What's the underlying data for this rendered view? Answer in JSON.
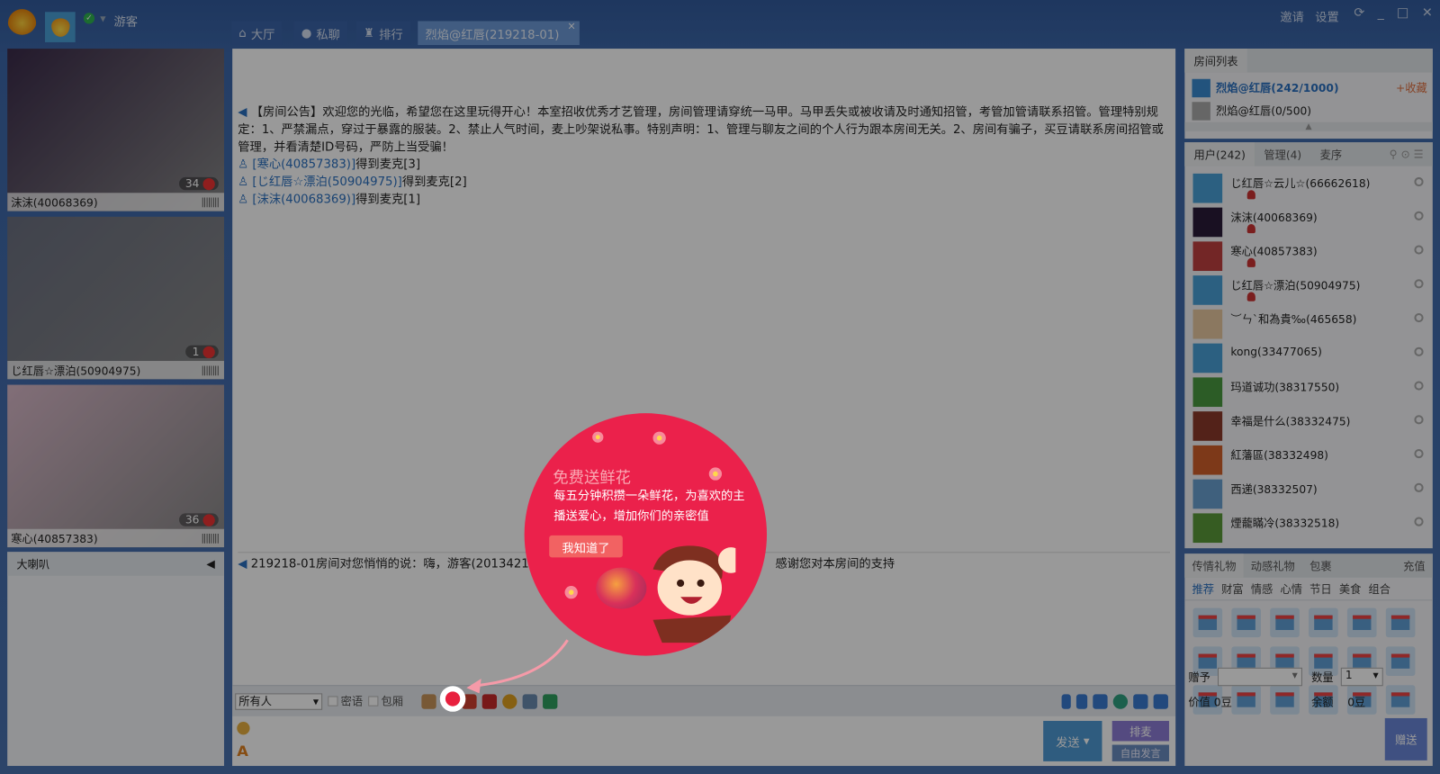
{
  "topbar": {
    "user": "游客",
    "tabs": [
      {
        "label": "大厅",
        "icon": "home-icon"
      },
      {
        "label": "私聊",
        "icon": "chat-bubbles-icon"
      },
      {
        "label": "排行",
        "icon": "trophy-icon"
      },
      {
        "label": "烈焰@红唇(219218-01)",
        "close": "×"
      }
    ],
    "links": [
      "邀请",
      "设置"
    ],
    "win": [
      "⟳",
      "_",
      "□",
      "✕"
    ]
  },
  "videos": [
    {
      "name": "沫沫(40068369)",
      "count": "34",
      "bg": "#3b2b4a"
    },
    {
      "name": "じ红唇☆漂泊(50904975)",
      "count": "1",
      "bg": "#6b7080"
    },
    {
      "name": "寒心(40857383)",
      "count": "36",
      "bg": "#d8b8c8"
    }
  ],
  "horn": {
    "title": "大喇叭"
  },
  "chat": {
    "announce_tag": "【房间公告】",
    "announce": "欢迎您的光临，希望您在这里玩得开心！本室招收优秀才艺管理，房间管理请穿统一马甲。马甲丢失或被收请及时通知招管，考管加管请联系招管。管理特别规定：1、严禁漏点，穿过于暴露的服装。2、禁止人气时间，麦上吵架说私事。特别声明：1、管理与聊友之间的个人行为跟本房间无关。2、房间有骗子，买豆请联系房间招管或管理，并看清楚ID号码，严防上当受骗！",
    "mic": [
      {
        "user": "[寒心(40857383)]",
        "text": "得到麦克[3]"
      },
      {
        "user": "[じ红唇☆漂泊(50904975)]",
        "text": "得到麦克[2]"
      },
      {
        "user": "[沫沫(40068369)]",
        "text": "得到麦克[1]"
      }
    ],
    "private_msg_a": "219218-01房间对您悄悄的说：嗨，游客(20134212",
    "private_msg_b": "感谢您对本房间的支持"
  },
  "toolbar": {
    "target": "所有人",
    "whisper": "密语",
    "private_room": "包厢"
  },
  "input": {
    "send": "发送",
    "queue": "排麦",
    "free": "自由发言"
  },
  "rooms": {
    "title": "房间列表",
    "items": [
      {
        "name": "烈焰@红唇(242/1000)",
        "fav": "+收藏"
      },
      {
        "name": "烈焰@红唇(0/500)"
      }
    ]
  },
  "users": {
    "tabs": [
      "用户(242)",
      "管理(4)",
      "麦序"
    ],
    "list": [
      {
        "name": "じ红唇☆云儿☆(66662618)",
        "av": "#4aa0d8",
        "mic": true
      },
      {
        "name": "沫沫(40068369)",
        "av": "#2a1c3a",
        "mic": true
      },
      {
        "name": "寒心(40857383)",
        "av": "#c04040",
        "mic": true
      },
      {
        "name": "じ红唇☆漂泊(50904975)",
        "av": "#4aa0d8",
        "mic": true
      },
      {
        "name": "︶ㄣ`和為貴‰(465658)",
        "av": "#e8c8a0"
      },
      {
        "name": "kong(33477065)",
        "av": "#4aa0d8"
      },
      {
        "name": "玛道诚功(38317550)",
        "av": "#4a9a40"
      },
      {
        "name": "幸福是什么(38332475)",
        "av": "#8a3a2a"
      },
      {
        "name": "紅藩區(38332498)",
        "av": "#d0602a"
      },
      {
        "name": "西递(38332507)",
        "av": "#6aa0d0"
      },
      {
        "name": "煙蘢瞞冷(38332518)",
        "av": "#5a9a3a"
      }
    ]
  },
  "gifts": {
    "tabs": [
      "传情礼物",
      "动感礼物",
      "包裹"
    ],
    "recharge": "充值",
    "cats": [
      "推荐",
      "财富",
      "情感",
      "心情",
      "节日",
      "美食",
      "组合"
    ],
    "give_to": "赠予",
    "qty_label": "数量",
    "qty": "1",
    "value_label": "价值",
    "value": "0豆",
    "balance_label": "余额",
    "balance": "0豆",
    "give": "赠送"
  },
  "popup": {
    "title": "免费送鲜花",
    "desc": "每五分钟积攒一朵鲜花，为喜欢的主播送爱心，增加你们的亲密值",
    "ok": "我知道了"
  }
}
